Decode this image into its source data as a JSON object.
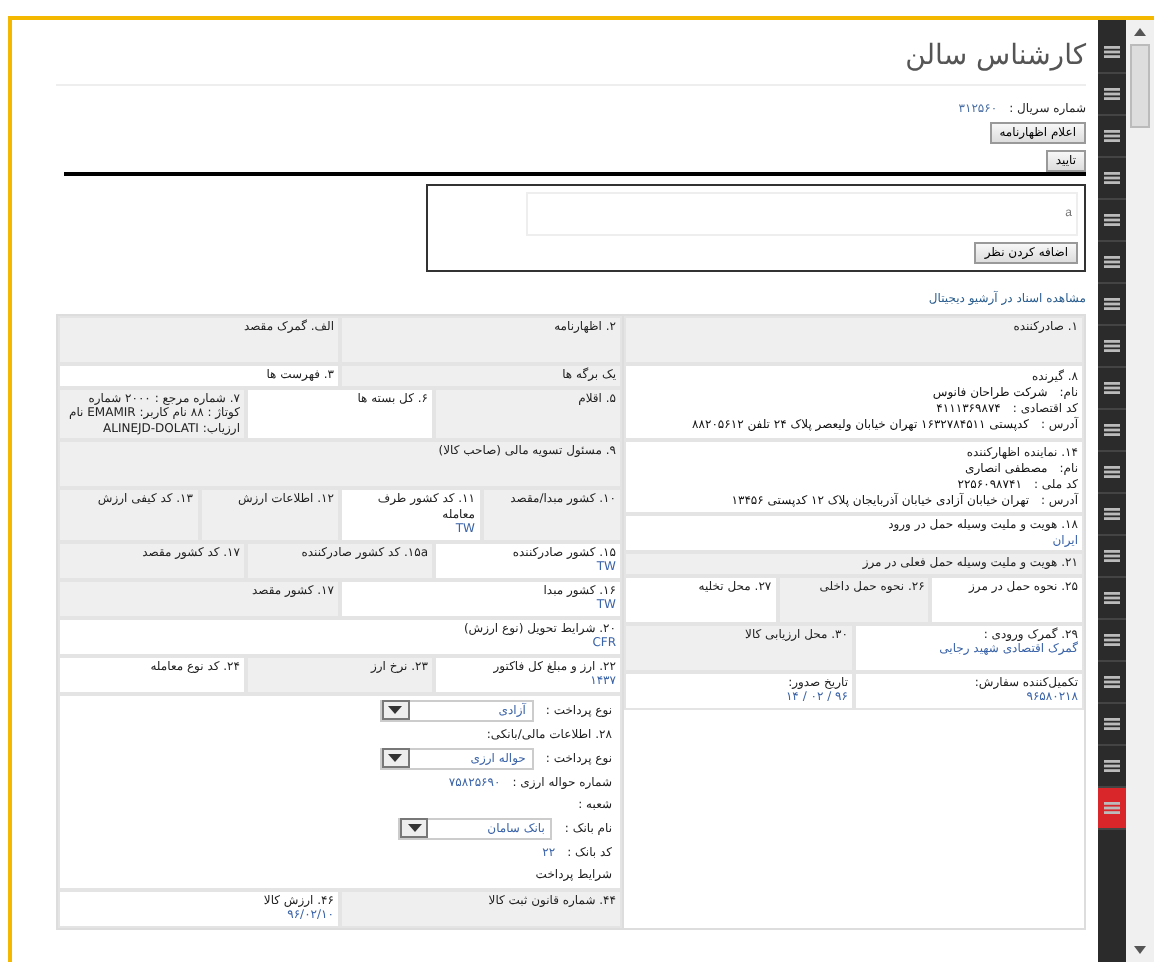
{
  "page": {
    "title": "کارشناس سالن"
  },
  "serial": {
    "label": "شماره سریال :",
    "value": "۳۱۲۵۶۰"
  },
  "buttons": {
    "declare": "اعلام اظهارنامه",
    "confirm": "تایید",
    "add_comment": "اضافه کردن نظر"
  },
  "comment": {
    "placeholder": "a"
  },
  "archive_link": "مشاهده اسناد در آرشیو دیجیتال",
  "form": {
    "right": [
      {
        "kind": "tallrow",
        "cells": [
          {
            "label": "۱. صادرکننده",
            "shaded": true
          }
        ]
      },
      {
        "kind": "party",
        "label": "۸. گیرنده",
        "lines": [
          {
            "label": "نام:",
            "value": "شرکت طراحان فانوس"
          },
          {
            "label": "کد اقتصادی :",
            "value": "۴۱۱۱۳۶۹۸۷۴"
          },
          {
            "label": "آدرس :",
            "value": "کدپستی ۱۶۳۲۷۸۴۵۱۱ تهران خیابان ولیعصر پلاک ۲۴ تلفن ۸۸۲۰۵۶۱۲"
          }
        ]
      },
      {
        "kind": "party",
        "label": "۱۴. نماینده اظهارکننده",
        "lines": [
          {
            "label": "نام:",
            "value": "مصطفی انصاری"
          },
          {
            "label": "کد ملی :",
            "value": "۲۲۵۶۰۹۸۷۴۱"
          },
          {
            "label": "آدرس :",
            "value": "تهران خیابان آزادی خیابان آذربایجان پلاک ۱۲ کدپستی ۱۳۴۵۶"
          }
        ]
      },
      {
        "kind": "row",
        "cells": [
          {
            "label": "۱۸. هویت و ملیت وسیله حمل در ورود",
            "value": "ایران",
            "shaded": false
          }
        ]
      },
      {
        "kind": "row",
        "cells": [
          {
            "label": "۲۱. هویت و ملیت وسیله حمل فعلی در مرز",
            "shaded": true
          }
        ]
      },
      {
        "kind": "tallrow",
        "cells": [
          {
            "label": "۲۵. نحوه حمل در مرز",
            "shaded": false
          },
          {
            "label": "۲۶. نحوه حمل داخلی",
            "shaded": true
          },
          {
            "label": "۲۷. محل تخلیه",
            "shaded": false
          }
        ]
      },
      {
        "kind": "tallrow",
        "cells": [
          {
            "label": "۲۹. گمرک ورودی :",
            "value": "گمرک اقتصادی شهید رجایی",
            "shaded": false
          },
          {
            "label": "۳۰. محل ارزیابی کالا",
            "shaded": true
          }
        ]
      },
      {
        "kind": "row",
        "cells": [
          {
            "label": "تکمیل‌کننده سفارش:",
            "value": "۹۶۵۸۰۲۱۸",
            "shaded": false
          },
          {
            "label": "تاریخ صدور:",
            "value": "۹۶ / ۰۲ / ۱۴",
            "shaded": false
          }
        ]
      }
    ],
    "left": [
      {
        "kind": "tallrow",
        "cells": [
          {
            "label": "۲. اظهارنامه",
            "shaded": true
          },
          {
            "label": "الف. گمرک مقصد",
            "shaded": true
          }
        ]
      },
      {
        "kind": "row",
        "cells": [
          {
            "label": "یک برگه ها",
            "shaded": true
          },
          {
            "label": "۳. فهرست ها",
            "shaded": false
          }
        ]
      },
      {
        "kind": "row",
        "cells": [
          {
            "label": "۵. اقلام",
            "shaded": true
          },
          {
            "label": "۶. کل بسته ها",
            "shaded": false
          },
          {
            "label": "۷. شماره مرجع : ۲۰۰۰ شماره کوتاژ : ۸۸ نام کاربر: EMAMIR نام ارزیاب: ALINEJD-DOLATI",
            "shaded": true
          }
        ]
      },
      {
        "kind": "tallrow",
        "cells": [
          {
            "label": "۹. مسئول تسویه مالی (صاحب کالا)",
            "shaded": true
          }
        ]
      },
      {
        "kind": "tallrow",
        "cells": [
          {
            "label": "۱۰. کشور مبدا/مقصد",
            "shaded": true
          },
          {
            "label": "۱۱. کد کشور طرف معامله",
            "value": "TW",
            "shaded": false
          },
          {
            "label": "۱۲. اطلاعات ارزش",
            "shaded": true
          },
          {
            "label": "۱۳. کد کیفی ارزش",
            "shaded": true
          }
        ]
      },
      {
        "kind": "row",
        "cells": [
          {
            "label": "۱۵. کشور صادرکننده",
            "value": "TW",
            "shaded": false
          },
          {
            "label": "۱۵a. کد کشور صادرکننده",
            "shaded": true
          },
          {
            "label": "۱۷. کد کشور مقصد",
            "shaded": true
          }
        ]
      },
      {
        "kind": "row",
        "cells": [
          {
            "label": "۱۶. کشور مبدا",
            "value": "TW",
            "shaded": false
          },
          {
            "label": "۱۷. کشور مقصد",
            "shaded": true
          }
        ]
      },
      {
        "kind": "row",
        "cells": [
          {
            "label": "۲۰. شرایط تحویل (نوع ارزش)",
            "value": "CFR",
            "shaded": false
          }
        ]
      },
      {
        "kind": "row",
        "cells": [
          {
            "label": "۲۲. ارز و مبلغ کل فاکتور",
            "value": "۱۴۳۷",
            "shaded": false
          },
          {
            "label": "۲۳. نرخ ارز",
            "shaded": true
          },
          {
            "label": "۲۴. کد نوع معامله",
            "shaded": false
          }
        ]
      },
      {
        "kind": "payment",
        "lines": [
          {
            "kind": "select",
            "label": "نوع پرداخت :",
            "value": "آزادی"
          },
          {
            "kind": "heading",
            "label": "۲۸. اطلاعات مالی/بانکی:"
          },
          {
            "kind": "select",
            "label": "نوع پرداخت :",
            "value": "حواله ارزی"
          },
          {
            "kind": "text",
            "label": "شماره حواله ارزی :",
            "value": "۷۵۸۲۵۶۹۰"
          },
          {
            "kind": "text",
            "label": "شعبه :"
          },
          {
            "kind": "select",
            "label": "نام بانک :",
            "value": "بانک سامان"
          },
          {
            "kind": "text",
            "label": "کد بانک :",
            "value": "۲۲"
          },
          {
            "kind": "text",
            "label": "شرایط پرداخت"
          }
        ]
      },
      {
        "kind": "row",
        "cells": [
          {
            "label": "۴۴. شماره قانون ثبت کالا",
            "shaded": true
          },
          {
            "label": "۴۶. ارزش کالا",
            "value": "۹۶/۰۲/۱۰",
            "shaded": false
          }
        ]
      }
    ]
  },
  "sidebar": {
    "items": [
      {
        "selected": false
      },
      {
        "selected": false
      },
      {
        "selected": false
      },
      {
        "selected": false
      },
      {
        "selected": false
      },
      {
        "selected": false
      },
      {
        "selected": false
      },
      {
        "selected": false
      },
      {
        "selected": false
      },
      {
        "selected": false
      },
      {
        "selected": false
      },
      {
        "selected": false
      },
      {
        "selected": false
      },
      {
        "selected": false
      },
      {
        "selected": false
      },
      {
        "selected": false
      },
      {
        "selected": false
      },
      {
        "selected": false
      },
      {
        "selected": true
      }
    ]
  }
}
